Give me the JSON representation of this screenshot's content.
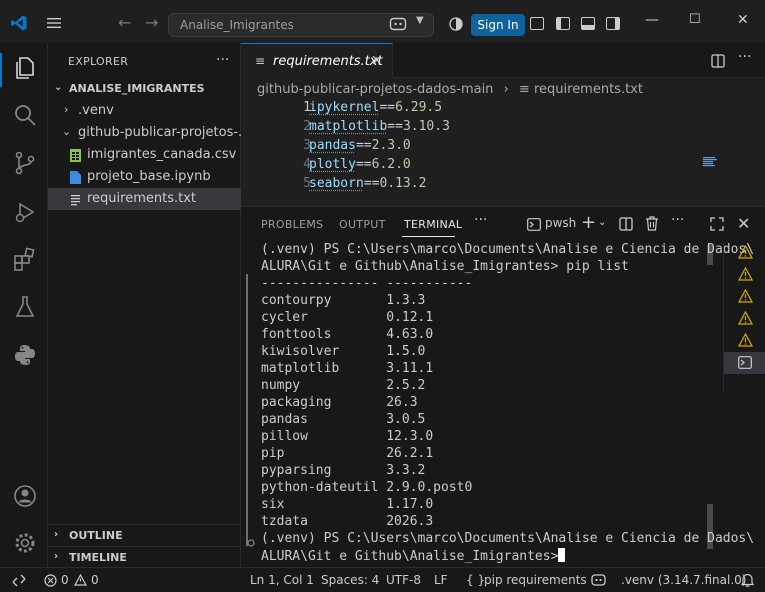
{
  "titlebar": {
    "search_text": "Analise_Imigrantes",
    "signin_label": "Sign In"
  },
  "explorer": {
    "title": "EXPLORER",
    "root_label": "ANALISE_IMIGRANTES",
    "items": [
      {
        "label": ".venv",
        "type": "folder-collapsed"
      },
      {
        "label": "github-publicar-projetos-...",
        "type": "folder-expanded"
      },
      {
        "label": "imigrantes_canada.csv",
        "type": "csv-file"
      },
      {
        "label": "projeto_base.ipynb",
        "type": "notebook-file"
      },
      {
        "label": "requirements.txt",
        "type": "text-file"
      }
    ],
    "outline_label": "OUTLINE",
    "timeline_label": "TIMELINE"
  },
  "editor": {
    "tab_label": "requirements.txt",
    "breadcrumb": [
      "github-publicar-projetos-dados-main",
      "requirements.txt"
    ],
    "lines": [
      {
        "num": "1",
        "pkg": "ipykernel",
        "op": "==",
        "ver": "6.29.5"
      },
      {
        "num": "2",
        "pkg": "matplotlib",
        "op": "==",
        "ver": "3.10.3"
      },
      {
        "num": "3",
        "pkg": "pandas",
        "op": "==",
        "ver": "2.3.0"
      },
      {
        "num": "4",
        "pkg": "plotly",
        "op": "==",
        "ver": "6.2.0"
      },
      {
        "num": "5",
        "pkg": "seaborn",
        "op": "==",
        "ver": "0.13.2"
      }
    ]
  },
  "panel": {
    "tabs": [
      "PROBLEMS",
      "OUTPUT",
      "TERMINAL"
    ],
    "active_tab": "TERMINAL",
    "shell_label": "pwsh",
    "terminal_lines": [
      "(.venv) PS C:\\Users\\marco\\Documents\\Analise e Ciencia de Dados\\",
      "ALURA\\Git e Github\\Analise_Imigrantes> pip list",
      "--------------- -----------",
      "contourpy       1.3.3",
      "cycler          0.12.1",
      "fonttools       4.63.0",
      "kiwisolver      1.5.0",
      "matplotlib      3.11.1",
      "numpy           2.5.2",
      "packaging       26.3",
      "pandas          3.0.5",
      "pillow          12.3.0",
      "pip             26.2.1",
      "pyparsing       3.3.2",
      "python-dateutil 2.9.0.post0",
      "six             1.17.0",
      "tzdata          2026.3",
      "(.venv) PS C:\\Users\\marco\\Documents\\Analise e Ciencia de Dados\\",
      "ALURA\\Git e Github\\Analise_Imigrantes>"
    ]
  },
  "statusbar": {
    "errors": "0",
    "warnings": "0",
    "position": "Ln 1, Col 1",
    "spaces": "Spaces: 4",
    "encoding": "UTF-8",
    "eol": "LF",
    "language": "pip requirements",
    "interpreter": ".venv (3.14.7.final.0)"
  },
  "colors": {
    "accent": "#0078d4",
    "signin_bg": "#0e639c",
    "warning": "#cca700"
  }
}
